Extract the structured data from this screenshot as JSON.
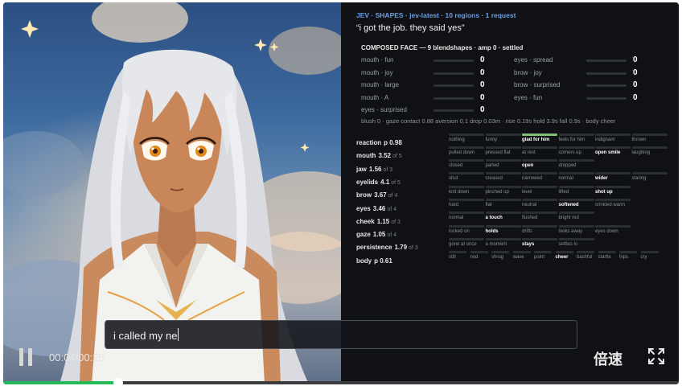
{
  "panel": {
    "header": "JEV · SHAPES · jev-latest · 10 regions · 1 request",
    "quote": "“i got the job. they said yes”",
    "composed_title": "COMPOSED FACE — 9 blendshapes · amp 0 · settled",
    "blendshapes": [
      {
        "label": "mouth · fun",
        "value": "0"
      },
      {
        "label": "mouth · joy",
        "value": "0"
      },
      {
        "label": "mouth · large",
        "value": "0"
      },
      {
        "label": "mouth · A",
        "value": "0"
      },
      {
        "label": "eyes · surprised",
        "value": "0"
      },
      {
        "label": "eyes · spread",
        "value": "0"
      },
      {
        "label": "brow · joy",
        "value": "0"
      },
      {
        "label": "brow · surprised",
        "value": "0"
      },
      {
        "label": "eyes · fun",
        "value": "0"
      }
    ],
    "summary": "blush 0 · gaze contact 0.88 aversion 0.1 drop 0.03m · rise 0.19s hold 3.9s fall 0.9s · body cheer",
    "regions": [
      {
        "name": "reaction",
        "value": "p 0.98",
        "of": "",
        "options": [
          {
            "t": "nothing"
          },
          {
            "t": "funny"
          },
          {
            "t": "glad for him",
            "s": true,
            "g": true
          },
          {
            "t": "feels for him"
          },
          {
            "t": "indignant"
          },
          {
            "t": "thrown"
          }
        ]
      },
      {
        "name": "mouth",
        "value": "3.52",
        "of": "of 5",
        "options": [
          {
            "t": "pulled down"
          },
          {
            "t": "pressed flat"
          },
          {
            "t": "at rest"
          },
          {
            "t": "corners up"
          },
          {
            "t": "open smile",
            "s": true
          },
          {
            "t": "laughing"
          }
        ]
      },
      {
        "name": "jaw",
        "value": "1.56",
        "of": "of 3",
        "options": [
          {
            "t": "closed"
          },
          {
            "t": "parted"
          },
          {
            "t": "open",
            "s": true
          },
          {
            "t": "dropped"
          }
        ]
      },
      {
        "name": "eyelids",
        "value": "4.1",
        "of": "of 5",
        "options": [
          {
            "t": "shut"
          },
          {
            "t": "creased"
          },
          {
            "t": "narrowed"
          },
          {
            "t": "normal"
          },
          {
            "t": "wider",
            "s": true
          },
          {
            "t": "staring"
          }
        ]
      },
      {
        "name": "brow",
        "value": "3.67",
        "of": "of 4",
        "options": [
          {
            "t": "knit down"
          },
          {
            "t": "pinched up"
          },
          {
            "t": "level"
          },
          {
            "t": "lifted"
          },
          {
            "t": "shot up",
            "s": true
          }
        ]
      },
      {
        "name": "eyes",
        "value": "3.46",
        "of": "of 4",
        "options": [
          {
            "t": "hard"
          },
          {
            "t": "flat"
          },
          {
            "t": "neutral"
          },
          {
            "t": "softened",
            "s": true
          },
          {
            "t": "crinkled warm"
          }
        ]
      },
      {
        "name": "cheek",
        "value": "1.15",
        "of": "of 3",
        "options": [
          {
            "t": "normal"
          },
          {
            "t": "a touch",
            "s": true
          },
          {
            "t": "flushed"
          },
          {
            "t": "bright red"
          }
        ]
      },
      {
        "name": "gaze",
        "value": "1.05",
        "of": "of 4",
        "options": [
          {
            "t": "locked on"
          },
          {
            "t": "holds",
            "s": true
          },
          {
            "t": "drifts"
          },
          {
            "t": "looks away"
          },
          {
            "t": "eyes down"
          }
        ]
      },
      {
        "name": "persistence",
        "value": "1.79",
        "of": "of 3",
        "options": [
          {
            "t": "gone at once"
          },
          {
            "t": "a moment"
          },
          {
            "t": "stays",
            "s": true
          },
          {
            "t": "settles in"
          }
        ]
      },
      {
        "name": "body",
        "value": "p 0.61",
        "of": "",
        "options": [
          {
            "t": "still"
          },
          {
            "t": "nod"
          },
          {
            "t": "shrug"
          },
          {
            "t": "wave"
          },
          {
            "t": "point"
          },
          {
            "t": "cheer",
            "s": true
          },
          {
            "t": "bashful"
          },
          {
            "t": "startle"
          },
          {
            "t": "hips"
          },
          {
            "t": "cry"
          }
        ]
      }
    ]
  },
  "caption": {
    "text": "i called my ne"
  },
  "controls": {
    "time": "00:04/00:25",
    "speed": "倍速",
    "progress": 0.17
  },
  "colors": {
    "accent_blue": "#6d9fe6",
    "selected_green": "#7fbf72",
    "progress_green": "#27b85a"
  }
}
